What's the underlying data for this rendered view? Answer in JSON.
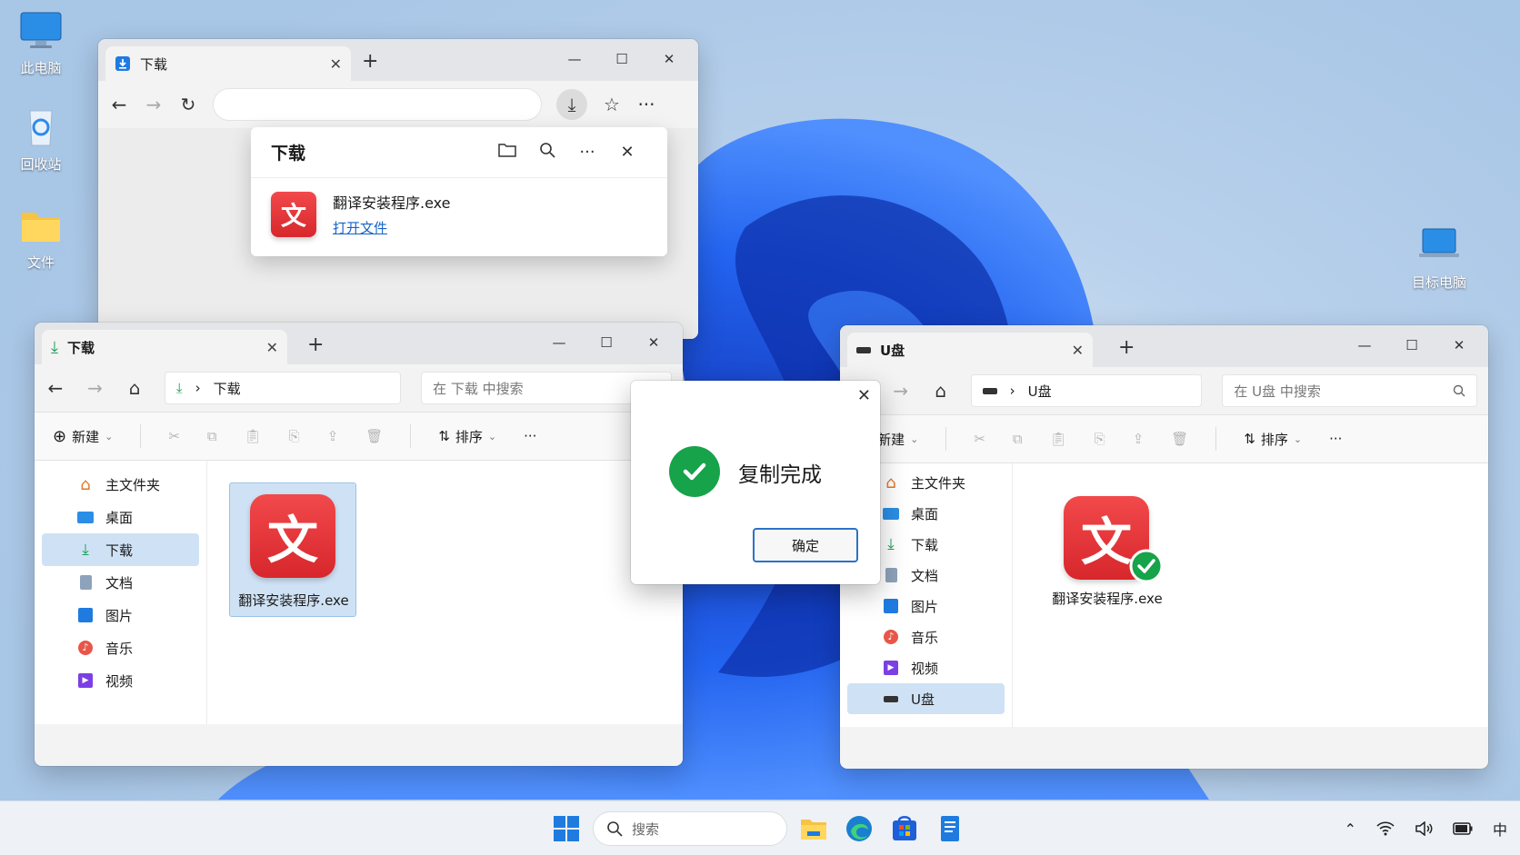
{
  "desktop": {
    "icons": [
      {
        "label": "此电脑"
      },
      {
        "label": "回收站"
      },
      {
        "label": "文件"
      }
    ],
    "right_icon": {
      "label": "目标电脑"
    }
  },
  "browser": {
    "tab_title": "下载",
    "download_panel": {
      "title": "下载",
      "file_name": "翻译安装程序.exe",
      "open_link": "打开文件",
      "app_glyph": "文"
    }
  },
  "explorer_left": {
    "tab_title": "下载",
    "breadcrumb": "下载",
    "search_placeholder": "在 下载 中搜索",
    "toolbar": {
      "new_label": "新建",
      "sort_label": "排序"
    },
    "sidebar": [
      {
        "label": "主文件夹",
        "icon": "home-icon"
      },
      {
        "label": "桌面",
        "icon": "desktop-icon"
      },
      {
        "label": "下载",
        "icon": "download-icon",
        "active": true
      },
      {
        "label": "文档",
        "icon": "document-icon"
      },
      {
        "label": "图片",
        "icon": "picture-icon"
      },
      {
        "label": "音乐",
        "icon": "music-icon"
      },
      {
        "label": "视频",
        "icon": "video-icon"
      }
    ],
    "file": {
      "name": "翻译安装程序.exe",
      "glyph": "文"
    }
  },
  "explorer_right": {
    "tab_title": "U盘",
    "breadcrumb": "U盘",
    "search_placeholder": "在 U盘 中搜索",
    "toolbar": {
      "new_label": "新建",
      "sort_label": "排序"
    },
    "sidebar": [
      {
        "label": "主文件夹",
        "icon": "home-icon"
      },
      {
        "label": "桌面",
        "icon": "desktop-icon"
      },
      {
        "label": "下载",
        "icon": "download-icon"
      },
      {
        "label": "文档",
        "icon": "document-icon"
      },
      {
        "label": "图片",
        "icon": "picture-icon"
      },
      {
        "label": "音乐",
        "icon": "music-icon"
      },
      {
        "label": "视频",
        "icon": "video-icon"
      },
      {
        "label": "U盘",
        "icon": "usb-drive-icon",
        "active": true
      }
    ],
    "file": {
      "name": "翻译安装程序.exe",
      "glyph": "文"
    }
  },
  "dialog": {
    "message": "复制完成",
    "ok_label": "确定"
  },
  "taskbar": {
    "search_placeholder": "搜索",
    "ime_indicator": "中"
  },
  "colors": {
    "accent": "#1464c8",
    "app_red": "#e2363a",
    "success_green": "#16a34a",
    "selection": "#cfe2f5"
  }
}
